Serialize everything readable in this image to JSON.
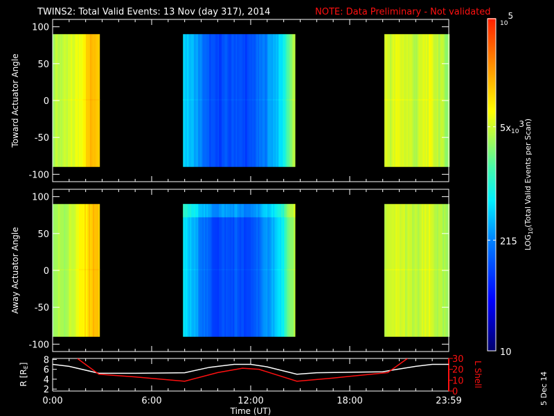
{
  "title": "TWINS2: Total Valid Events: 13 Nov (day 317), 2014",
  "note": "NOTE: Data Preliminary - Not validated",
  "date_stamp": "5 Dec 14",
  "colors": {
    "background": "#000000",
    "axes": "#ffffff",
    "note": "#ff1010",
    "lshell": "#ff1010",
    "r_line": "#ffffff"
  },
  "chart_data": [
    {
      "type": "heatmap",
      "name": "toward",
      "ylabel": "Toward Actuator Angle",
      "ylim": [
        -110,
        110
      ],
      "yticks": [
        "100",
        "50",
        "0",
        "-50",
        "-100"
      ],
      "ytick_values": [
        100,
        50,
        0,
        -50,
        -100
      ],
      "data_angle_range": [
        -90,
        90
      ],
      "xlim_hours": [
        0,
        24
      ],
      "segments": [
        {
          "start_h": 0.0,
          "end_h": 2.8,
          "log_values": [
            3.55,
            3.6,
            3.65,
            3.6,
            3.7,
            3.75,
            3.8,
            3.9,
            4.05,
            4.2,
            4.25,
            4.2
          ]
        },
        {
          "start_h": 7.9,
          "end_h": 14.7,
          "log_values": [
            2.7,
            2.6,
            2.5,
            2.3,
            2.1,
            2.0,
            1.95,
            2.05,
            2.0,
            2.1,
            2.0,
            1.95,
            2.1,
            2.2,
            2.3,
            2.5,
            2.6,
            2.8,
            3.3,
            3.6
          ]
        },
        {
          "start_h": 20.1,
          "end_h": 24.0,
          "log_values": [
            3.75,
            3.7,
            3.8,
            3.75,
            3.7,
            3.6,
            3.75,
            3.8,
            3.7,
            3.6,
            3.5
          ]
        }
      ]
    },
    {
      "type": "heatmap",
      "name": "away",
      "ylabel": "Away Actuator Angle",
      "ylim": [
        -110,
        110
      ],
      "yticks": [
        "100",
        "50",
        "0",
        "-50",
        "-100"
      ],
      "ytick_values": [
        100,
        50,
        0,
        -50,
        -100
      ],
      "data_angle_range": [
        -90,
        90
      ],
      "xlim_hours": [
        0,
        24
      ],
      "segments": [
        {
          "start_h": 0.0,
          "end_h": 2.8,
          "log_values": [
            3.5,
            3.55,
            3.6,
            3.55,
            3.65,
            3.7,
            3.8,
            3.9,
            4.0,
            4.15,
            4.2,
            4.15
          ]
        },
        {
          "start_h": 7.9,
          "end_h": 14.7,
          "log_values": [
            2.75,
            2.6,
            2.5,
            2.3,
            2.15,
            2.0,
            1.95,
            2.05,
            2.0,
            2.1,
            2.0,
            1.9,
            2.1,
            2.2,
            2.35,
            2.5,
            2.65,
            2.85,
            3.3,
            3.6
          ],
          "high_angle_band": {
            "from_deg": 72,
            "to_deg": 90,
            "log_boost": 0.45
          }
        },
        {
          "start_h": 20.1,
          "end_h": 24.0,
          "log_values": [
            3.7,
            3.65,
            3.75,
            3.7,
            3.65,
            3.6,
            3.7,
            3.75,
            3.65,
            3.55,
            3.5
          ]
        }
      ]
    },
    {
      "type": "line",
      "name": "orbit",
      "xlabel": "Time (UT)",
      "xticks": [
        "0:00",
        "6:00",
        "12:00",
        "18:00",
        "23:59"
      ],
      "xtick_hours": [
        0,
        6,
        12,
        18,
        24
      ],
      "ylabel_left": "R [R",
      "ylabel_left_sub": "E",
      "ylabel_left_end": "]",
      "ylim_left": [
        1.6,
        8.2
      ],
      "yticks_left": [
        "8",
        "6",
        "4",
        "2"
      ],
      "ytick_left_values": [
        8,
        6,
        4,
        2
      ],
      "ylabel_right": "L Shell",
      "ylim_right": [
        0,
        30
      ],
      "yticks_right": [
        "30",
        "20",
        "10",
        "0"
      ],
      "ytick_right_values": [
        30,
        20,
        10,
        0
      ],
      "series": [
        {
          "name": "R",
          "axis": "left",
          "x": [
            0,
            1,
            2.8,
            5,
            8,
            9.5,
            11,
            12,
            13,
            14.8,
            16,
            20,
            20.5,
            22,
            23,
            24
          ],
          "y": [
            7.0,
            6.6,
            5.2,
            5.2,
            5.3,
            6.4,
            7.0,
            7.0,
            6.5,
            5.0,
            5.3,
            5.5,
            5.8,
            6.6,
            7.0,
            7.0
          ]
        },
        {
          "name": "L Shell",
          "axis": "right",
          "x": [
            1.5,
            2.8,
            5,
            8,
            10,
            11.5,
            12.5,
            14.8,
            17,
            20.3,
            21.5
          ],
          "y": [
            30,
            15.5,
            13,
            9,
            17,
            21,
            20,
            9,
            12,
            17,
            30
          ]
        }
      ]
    }
  ],
  "colorbar": {
    "label_log": "LOG",
    "label_log_sub": "10",
    "label_rest": "(Total Valid  Events per Scan)",
    "range_log10": [
      1,
      5
    ],
    "ticks": [
      {
        "label": "10",
        "log": 1
      },
      {
        "label": "215",
        "log": 2.333
      },
      {
        "label_main": "5x",
        "label_base": "10",
        "label_exp": "3",
        "log": 3.699
      },
      {
        "label_base": "10",
        "label_exp": "5",
        "log": 5
      }
    ]
  }
}
